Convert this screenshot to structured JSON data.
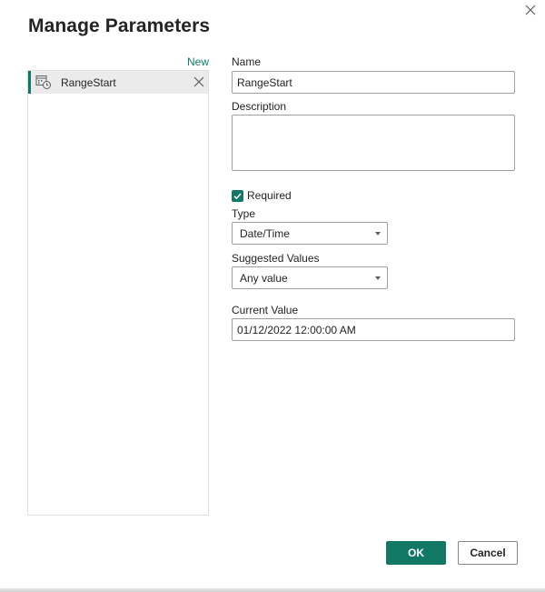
{
  "dialog": {
    "title": "Manage Parameters"
  },
  "sidebar": {
    "new_label": "New",
    "items": [
      {
        "label": "RangeStart",
        "icon": "parameter-date-icon",
        "selected": true
      }
    ]
  },
  "form": {
    "name_label": "Name",
    "name_value": "RangeStart",
    "description_label": "Description",
    "description_value": "",
    "required_label": "Required",
    "required_checked": true,
    "type_label": "Type",
    "type_value": "Date/Time",
    "suggested_label": "Suggested Values",
    "suggested_value": "Any value",
    "current_label": "Current Value",
    "current_value": "01/12/2022 12:00:00 AM"
  },
  "footer": {
    "ok_label": "OK",
    "cancel_label": "Cancel"
  },
  "colors": {
    "accent": "#117865",
    "link": "#0f7b69",
    "selected_bg": "#ebebeb",
    "border": "#a19f9d"
  }
}
